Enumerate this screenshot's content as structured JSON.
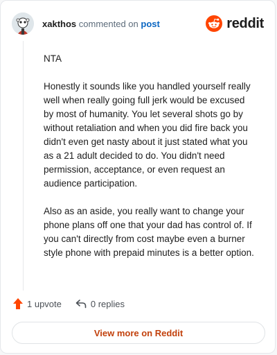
{
  "comment": {
    "username": "xakthos",
    "action_text": "commented on",
    "target_link": "post",
    "paragraphs": [
      "NTA",
      "Honestly it sounds like you handled yourself really well when really going full jerk would be excused by most of humanity. You let several shots go by without retaliation and when you did fire back you didn't even get nasty about it just stated what you as a 21 adult decided to do. You didn't need permission, acceptance, or even request an audience participation.",
      "Also as an aside, you really want to change your phone plans off one that your dad has control of. If you can't directly from cost maybe even a burner style phone with prepaid minutes is a better option."
    ]
  },
  "brand": {
    "wordmark": "reddit",
    "icon": "reddit-logo-icon",
    "color": "#ff4500"
  },
  "actions": {
    "upvote_label": "1 upvote",
    "upvote_icon": "upvote-arrow-icon",
    "replies_label": "0 replies",
    "replies_icon": "reply-arrow-icon"
  },
  "footer": {
    "view_label": "View more on Reddit"
  }
}
